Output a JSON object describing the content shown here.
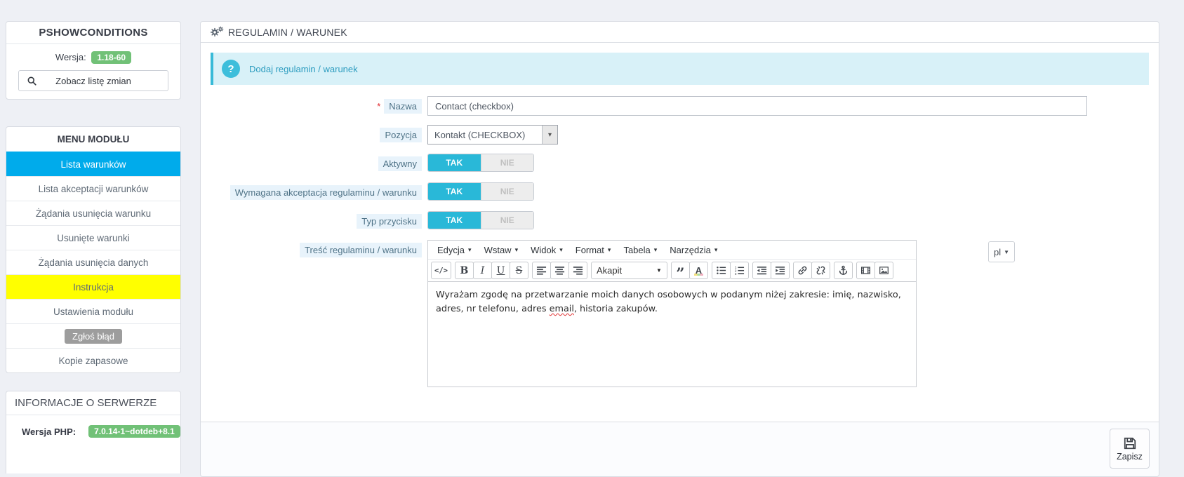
{
  "colors": {
    "accent_blue": "#00abeb",
    "toggle_cyan": "#29b8d8",
    "badge_green": "#71c177",
    "highlight_yellow": "#ffff00",
    "info_cyan": "#3dbedb"
  },
  "icons": {
    "caret_down": "▾",
    "caret_down_solid": "▼",
    "help": "?",
    "quote": "”",
    "text_color_letter": "A",
    "source_code": "</>",
    "bold": "B",
    "italic": "I",
    "underline": "U",
    "strikethrough": "S"
  },
  "sidebar": {
    "module_title": "PSHOWCONDITIONS",
    "version_label": "Wersja:",
    "version_value": "1.18-60",
    "changelog_button": "Zobacz listę zmian",
    "menu": {
      "title": "MENU MODUŁU",
      "items": [
        {
          "label": "Lista warunków"
        },
        {
          "label": "Lista akceptacji warunków"
        },
        {
          "label": "Żądania usunięcia warunku"
        },
        {
          "label": "Usunięte warunki"
        },
        {
          "label": "Żądania usunięcia danych"
        },
        {
          "label": "Instrukcja"
        },
        {
          "label": "Ustawienia modułu"
        },
        {
          "label": "Zgłoś błąd"
        },
        {
          "label": "Kopie zapasowe"
        }
      ]
    },
    "server_info": {
      "title": "INFORMACJE O SERWERZE",
      "php_label": "Wersja PHP:",
      "php_value": "7.0.14-1~dotdeb+8.1"
    }
  },
  "panel": {
    "title": "REGULAMIN / WARUNEK",
    "info_alert": "Dodaj regulamin / warunek",
    "form": {
      "name": {
        "required": "*",
        "label": "Nazwa",
        "value": "Contact (checkbox)"
      },
      "position": {
        "label": "Pozycja",
        "value": "Kontakt (CHECKBOX)"
      },
      "active": {
        "label": "Aktywny",
        "on": "TAK",
        "off": "NIE"
      },
      "acceptance": {
        "label": "Wymagana akceptacja regulaminu / warunku",
        "on": "TAK",
        "off": "NIE"
      },
      "button_type": {
        "label": "Typ przycisku",
        "on": "TAK",
        "off": "NIE"
      },
      "content_label": "Treść regulaminu / warunku"
    },
    "editor": {
      "menubar": [
        "Edycja",
        "Wstaw",
        "Widok",
        "Format",
        "Tabela",
        "Narzędzia"
      ],
      "format_select": "Akapit",
      "content": {
        "before": "Wyrażam zgodę na przetwarzanie moich danych osobowych w podanym niżej zakresie: imię, nazwisko, adres, nr telefonu, adres ",
        "misspelled": "email",
        "after": ", historia zakupów."
      }
    },
    "language_selector": "pl",
    "save_button": "Zapisz"
  }
}
